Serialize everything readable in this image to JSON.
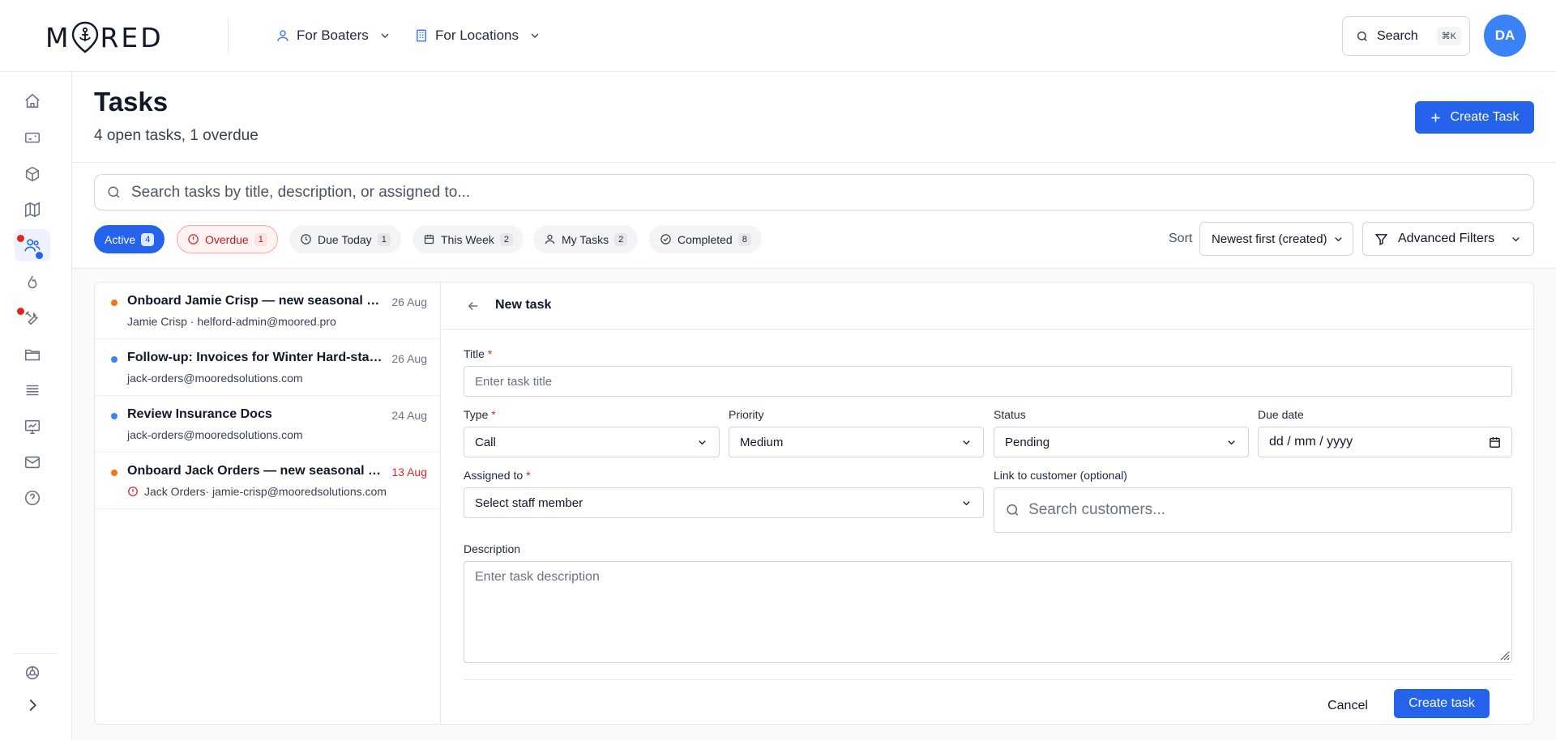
{
  "app": {
    "logo_left": "M",
    "logo_right": "RED"
  },
  "topnav": [
    {
      "label": "For Boaters"
    },
    {
      "label": "For Locations"
    }
  ],
  "search": {
    "label": "Search",
    "shortcut": "⌘K"
  },
  "user": {
    "initials": "DA"
  },
  "colors": {
    "accent": "#2563eb",
    "danger": "#dc2626",
    "orange": "#f97316",
    "blue": "#3b82f6"
  },
  "sidebar": {
    "items": [
      {
        "icon": "home-icon"
      },
      {
        "icon": "ticket-icon"
      },
      {
        "icon": "box-icon"
      },
      {
        "icon": "map-icon"
      },
      {
        "icon": "users-icon",
        "active": true
      },
      {
        "icon": "fire-icon"
      },
      {
        "icon": "tools-icon"
      },
      {
        "icon": "folder-icon"
      },
      {
        "icon": "list-icon"
      },
      {
        "icon": "chart-icon"
      },
      {
        "icon": "mail-icon"
      },
      {
        "icon": "help-icon"
      }
    ],
    "bottom": [
      {
        "icon": "settings-icon"
      },
      {
        "icon": "expand-icon"
      }
    ]
  },
  "page": {
    "title": "Tasks",
    "subtitle": "4 open tasks, 1 overdue",
    "create_button": "Create Task"
  },
  "task_search": {
    "placeholder": "Search tasks by title, description, or assigned to..."
  },
  "filters": [
    {
      "label": "Active",
      "count": "4",
      "state": "active"
    },
    {
      "label": "Overdue",
      "count": "1",
      "state": "overdue"
    },
    {
      "label": "Due Today",
      "count": "1"
    },
    {
      "label": "This Week",
      "count": "2"
    },
    {
      "label": "My Tasks",
      "count": "2"
    },
    {
      "label": "Completed",
      "count": "8"
    }
  ],
  "sort": {
    "label": "Sort",
    "value": "Newest first (created)"
  },
  "advanced_filters": {
    "label": "Advanced Filters"
  },
  "tasks": [
    {
      "title": "Onboard Jamie Crisp — new seasonal berth holder",
      "date": "26 Aug",
      "meta": "Jamie Crisp · helford-admin@moored.pro",
      "dot": "orange",
      "overdue": false
    },
    {
      "title": "Follow-up: Invoices for Winter Hard-standing",
      "date": "26 Aug",
      "meta": "jack-orders@mooredsolutions.com",
      "dot": "blue",
      "overdue": false
    },
    {
      "title": "Review Insurance Docs",
      "date": "24 Aug",
      "meta": "jack-orders@mooredsolutions.com",
      "dot": "blue",
      "overdue": false
    },
    {
      "title": "Onboard Jack Orders — new seasonal berth holder",
      "date": "13 Aug",
      "meta": "Jack Orders· jamie-crisp@mooredsolutions.com",
      "dot": "orange",
      "overdue": true
    }
  ],
  "form": {
    "heading": "New task",
    "title_label": "Title",
    "title_placeholder": "Enter task title",
    "type_label": "Type",
    "type_value": "Call",
    "priority_label": "Priority",
    "priority_value": "Medium",
    "status_label": "Status",
    "status_value": "Pending",
    "due_label": "Due date",
    "due_value": "dd / mm / yyyy",
    "assigned_label": "Assigned to",
    "assigned_value": "Select staff member",
    "customer_label": "Link to customer (optional)",
    "customer_placeholder": "Search customers...",
    "description_label": "Description",
    "description_placeholder": "Enter task description",
    "required_mark": "*",
    "cancel": "Cancel",
    "submit": "Create task"
  }
}
